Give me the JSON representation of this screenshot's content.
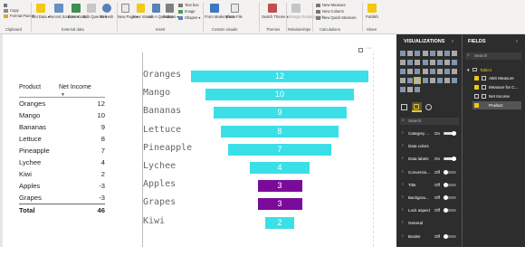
{
  "ribbon": {
    "clipboard": {
      "copy": "Copy",
      "format_painter": "Format Painter",
      "group": "Clipboard"
    },
    "external_data": {
      "get_data": "Get Data ▾",
      "recent_sources": "Recent Sources ▾",
      "enter_data": "Enter Data",
      "edit_queries": "Edit Queries ▾",
      "refresh": "Refresh",
      "group": "External data"
    },
    "insert": {
      "new_page": "New Page ▾",
      "new_visual": "New Visual",
      "ask_question": "Ask A Question",
      "buttons": "Buttons ▾",
      "text_box": "Text box",
      "image": "Image",
      "shapes": "Shapes ▾",
      "group": "Insert"
    },
    "custom_visuals": {
      "marketplace": "From Marketplace",
      "file": "From File",
      "group": "Custom visuals"
    },
    "themes": {
      "switch_theme": "Switch Theme ▾",
      "group": "Themes"
    },
    "relationships": {
      "manage": "Manage Relationships",
      "group": "Relationships"
    },
    "calculations": {
      "new_measure": "New Measure",
      "new_column": "New Column",
      "new_quick_measure": "New Quick Measure",
      "group": "Calculations"
    },
    "share": {
      "publish": "Publish",
      "group": "Share"
    }
  },
  "table": {
    "headers": [
      "Product",
      "Net Income"
    ],
    "rows": [
      {
        "product": "Oranges",
        "value": "12"
      },
      {
        "product": "Mango",
        "value": "10"
      },
      {
        "product": "Bananas",
        "value": "9"
      },
      {
        "product": "Lettuce",
        "value": "8"
      },
      {
        "product": "Pineapple",
        "value": "7"
      },
      {
        "product": "Lychee",
        "value": "4"
      },
      {
        "product": "Kiwi",
        "value": "2"
      },
      {
        "product": "Apples",
        "value": "-3"
      },
      {
        "product": "Grapes",
        "value": "-3"
      }
    ],
    "total_label": "Total",
    "total_value": "46"
  },
  "chart_data": {
    "type": "bar",
    "categories": [
      "Oranges",
      "Mango",
      "Bananas",
      "Lettuce",
      "Pineapple",
      "Lychee",
      "Apples",
      "Grapes",
      "Kiwi"
    ],
    "values": [
      12,
      10,
      9,
      8,
      7,
      4,
      3,
      3,
      2
    ],
    "data_labels": [
      "12",
      "10",
      "9",
      "8",
      "7",
      "4",
      "3",
      "3",
      "2"
    ],
    "bar_colors": [
      "#3bdfe8",
      "#3bdfe8",
      "#3bdfe8",
      "#3bdfe8",
      "#3bdfe8",
      "#3bdfe8",
      "#7a0a99",
      "#7a0a99",
      "#3bdfe8"
    ],
    "title": "",
    "xlabel": "",
    "ylabel": ""
  },
  "visualizations": {
    "title": "VISUALIZATIONS",
    "search_placeholder": "Search",
    "sections": [
      {
        "label": "Category ...",
        "state": "On"
      },
      {
        "label": "Data colors",
        "state": ""
      },
      {
        "label": "Data labels",
        "state": "On"
      },
      {
        "label": "Conversio...",
        "state": "Off"
      },
      {
        "label": "Title",
        "state": "Off"
      },
      {
        "label": "Backgrou...",
        "state": "Off"
      },
      {
        "label": "Lock aspect",
        "state": "Off"
      },
      {
        "label": "General",
        "state": ""
      },
      {
        "label": "Border",
        "state": "Off"
      }
    ]
  },
  "fields": {
    "title": "FIELDS",
    "search_placeholder": "Search",
    "table_name": "Table1",
    "items": [
      {
        "label": "ABS Measure"
      },
      {
        "label": "Measure for C..."
      },
      {
        "label": "Net Income"
      },
      {
        "label": "Product"
      }
    ]
  },
  "colors": {
    "accent_cyan": "#3bdfe8",
    "accent_purple": "#7a0a99",
    "panel_dark": "#2d2d2d",
    "field_yellow": "#f2c811"
  }
}
